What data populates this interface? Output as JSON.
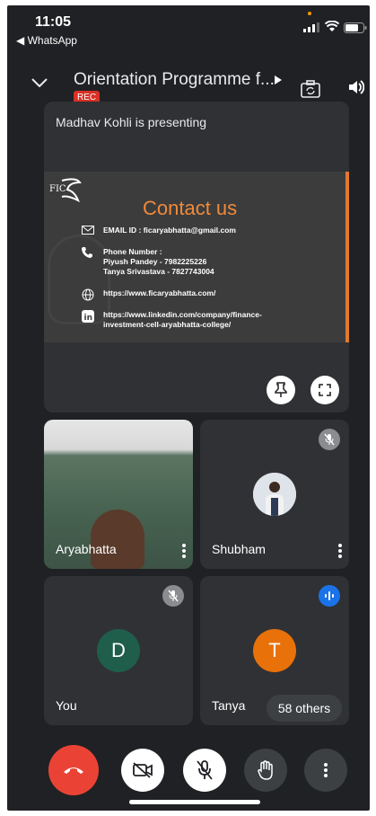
{
  "status_bar": {
    "time": "11:05",
    "back_app": "◀ WhatsApp"
  },
  "header": {
    "title": "Orientation Programme f...",
    "rec_label": "REC"
  },
  "presentation": {
    "presenter_text": "Madhav Kohli is presenting",
    "slide": {
      "heading": "Contact us",
      "email": "EMAIL ID : ficaryabhatta@gmail.com",
      "phone_label": "Phone Number :",
      "phone_1": "Piyush Pandey - 7982225226",
      "phone_2": "Tanya Srivastava - 7827743004",
      "website": "https://www.ficaryabhatta.com/",
      "linkedin_1": "https://www.linkedin.com/company/finance-",
      "linkedin_2": "investment-cell-aryabhatta-college/"
    }
  },
  "tiles": {
    "aryabhatta": {
      "name": "Aryabhatta"
    },
    "shubham": {
      "name": "Shubham"
    },
    "you": {
      "name": "You",
      "initial": "D",
      "avatar_color": "#1e5e4a"
    },
    "tanya": {
      "name": "Tanya",
      "initial": "T",
      "avatar_color": "#e8710a"
    },
    "others": "58 others"
  },
  "controls": {
    "end_call_color": "#ea4335",
    "icons": [
      "end-call-icon",
      "camera-off-icon",
      "mic-off-icon",
      "raise-hand-icon",
      "more-options-icon"
    ]
  }
}
